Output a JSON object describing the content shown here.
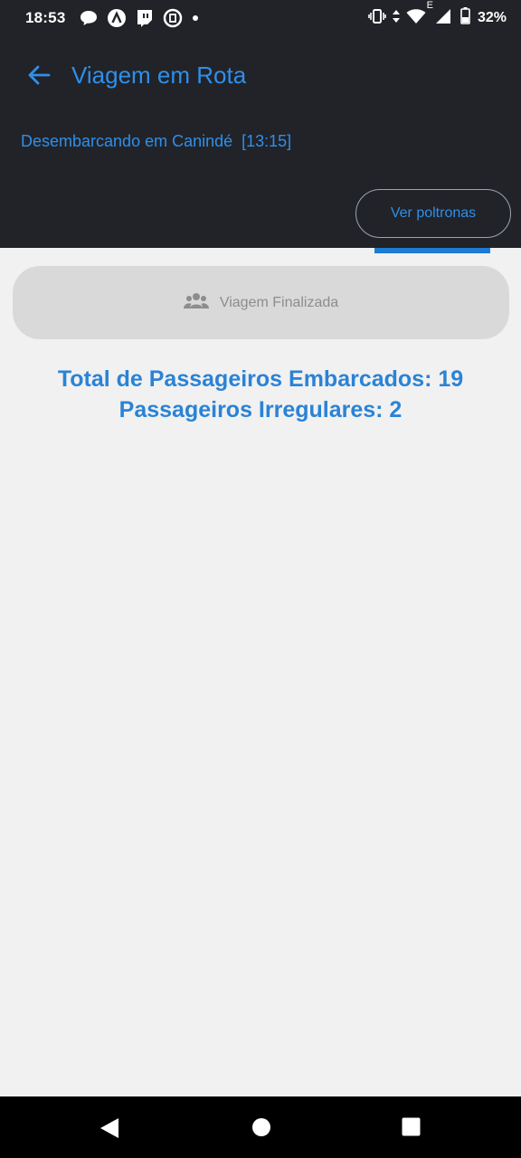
{
  "status_bar": {
    "time": "18:53",
    "left_icons": [
      "messaging-icon",
      "notification-a-icon",
      "twitch-icon",
      "screen-record-icon",
      "dot-icon"
    ],
    "right_icons": [
      "vibrate-icon",
      "data-arrows-icon",
      "wifi-icon",
      "signal-icon",
      "battery-icon"
    ],
    "network_letter": "E",
    "battery": "32%"
  },
  "header": {
    "title": "Viagem em Rota",
    "subtitle": "Desembarcando em Canindé  [13:15]",
    "seats_button_label": "Ver poltronas"
  },
  "trip_status": {
    "icon": "group-icon",
    "label": "Viagem Finalizada"
  },
  "summary": {
    "total_boarded": "Total de Passageiros Embarcados: 19",
    "irregular": "Passageiros Irregulares: 2"
  },
  "colors": {
    "header_bg": "#212328",
    "accent": "#2f8fea",
    "summary_text": "#2a83d6",
    "card_bg": "#d9d9d9",
    "page_bg": "#f1f1f1"
  }
}
